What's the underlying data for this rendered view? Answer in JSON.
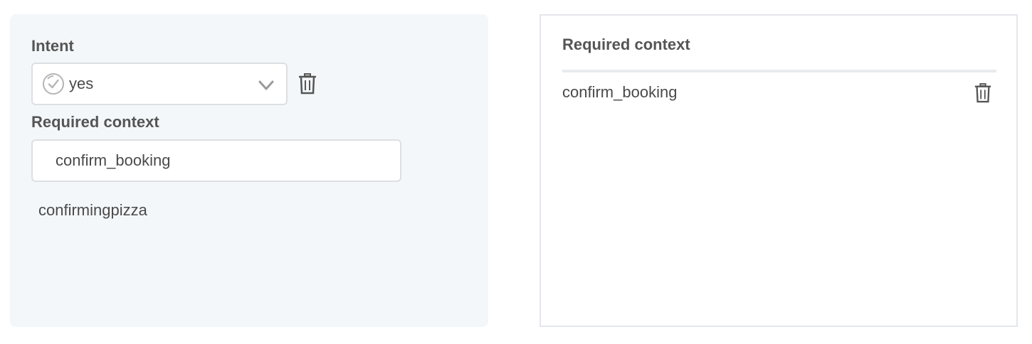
{
  "left": {
    "intent_label": "Intent",
    "intent_value": "yes",
    "required_context_label": "Required context",
    "context_input_value": "confirm_booking",
    "suggestion": "confirmingpizza",
    "icons": {
      "intent": "check-circle-icon",
      "dropdown": "chevron-down-icon",
      "delete": "trash-icon"
    }
  },
  "right": {
    "title": "Required context",
    "items": [
      {
        "label": "confirm_booking"
      }
    ]
  }
}
